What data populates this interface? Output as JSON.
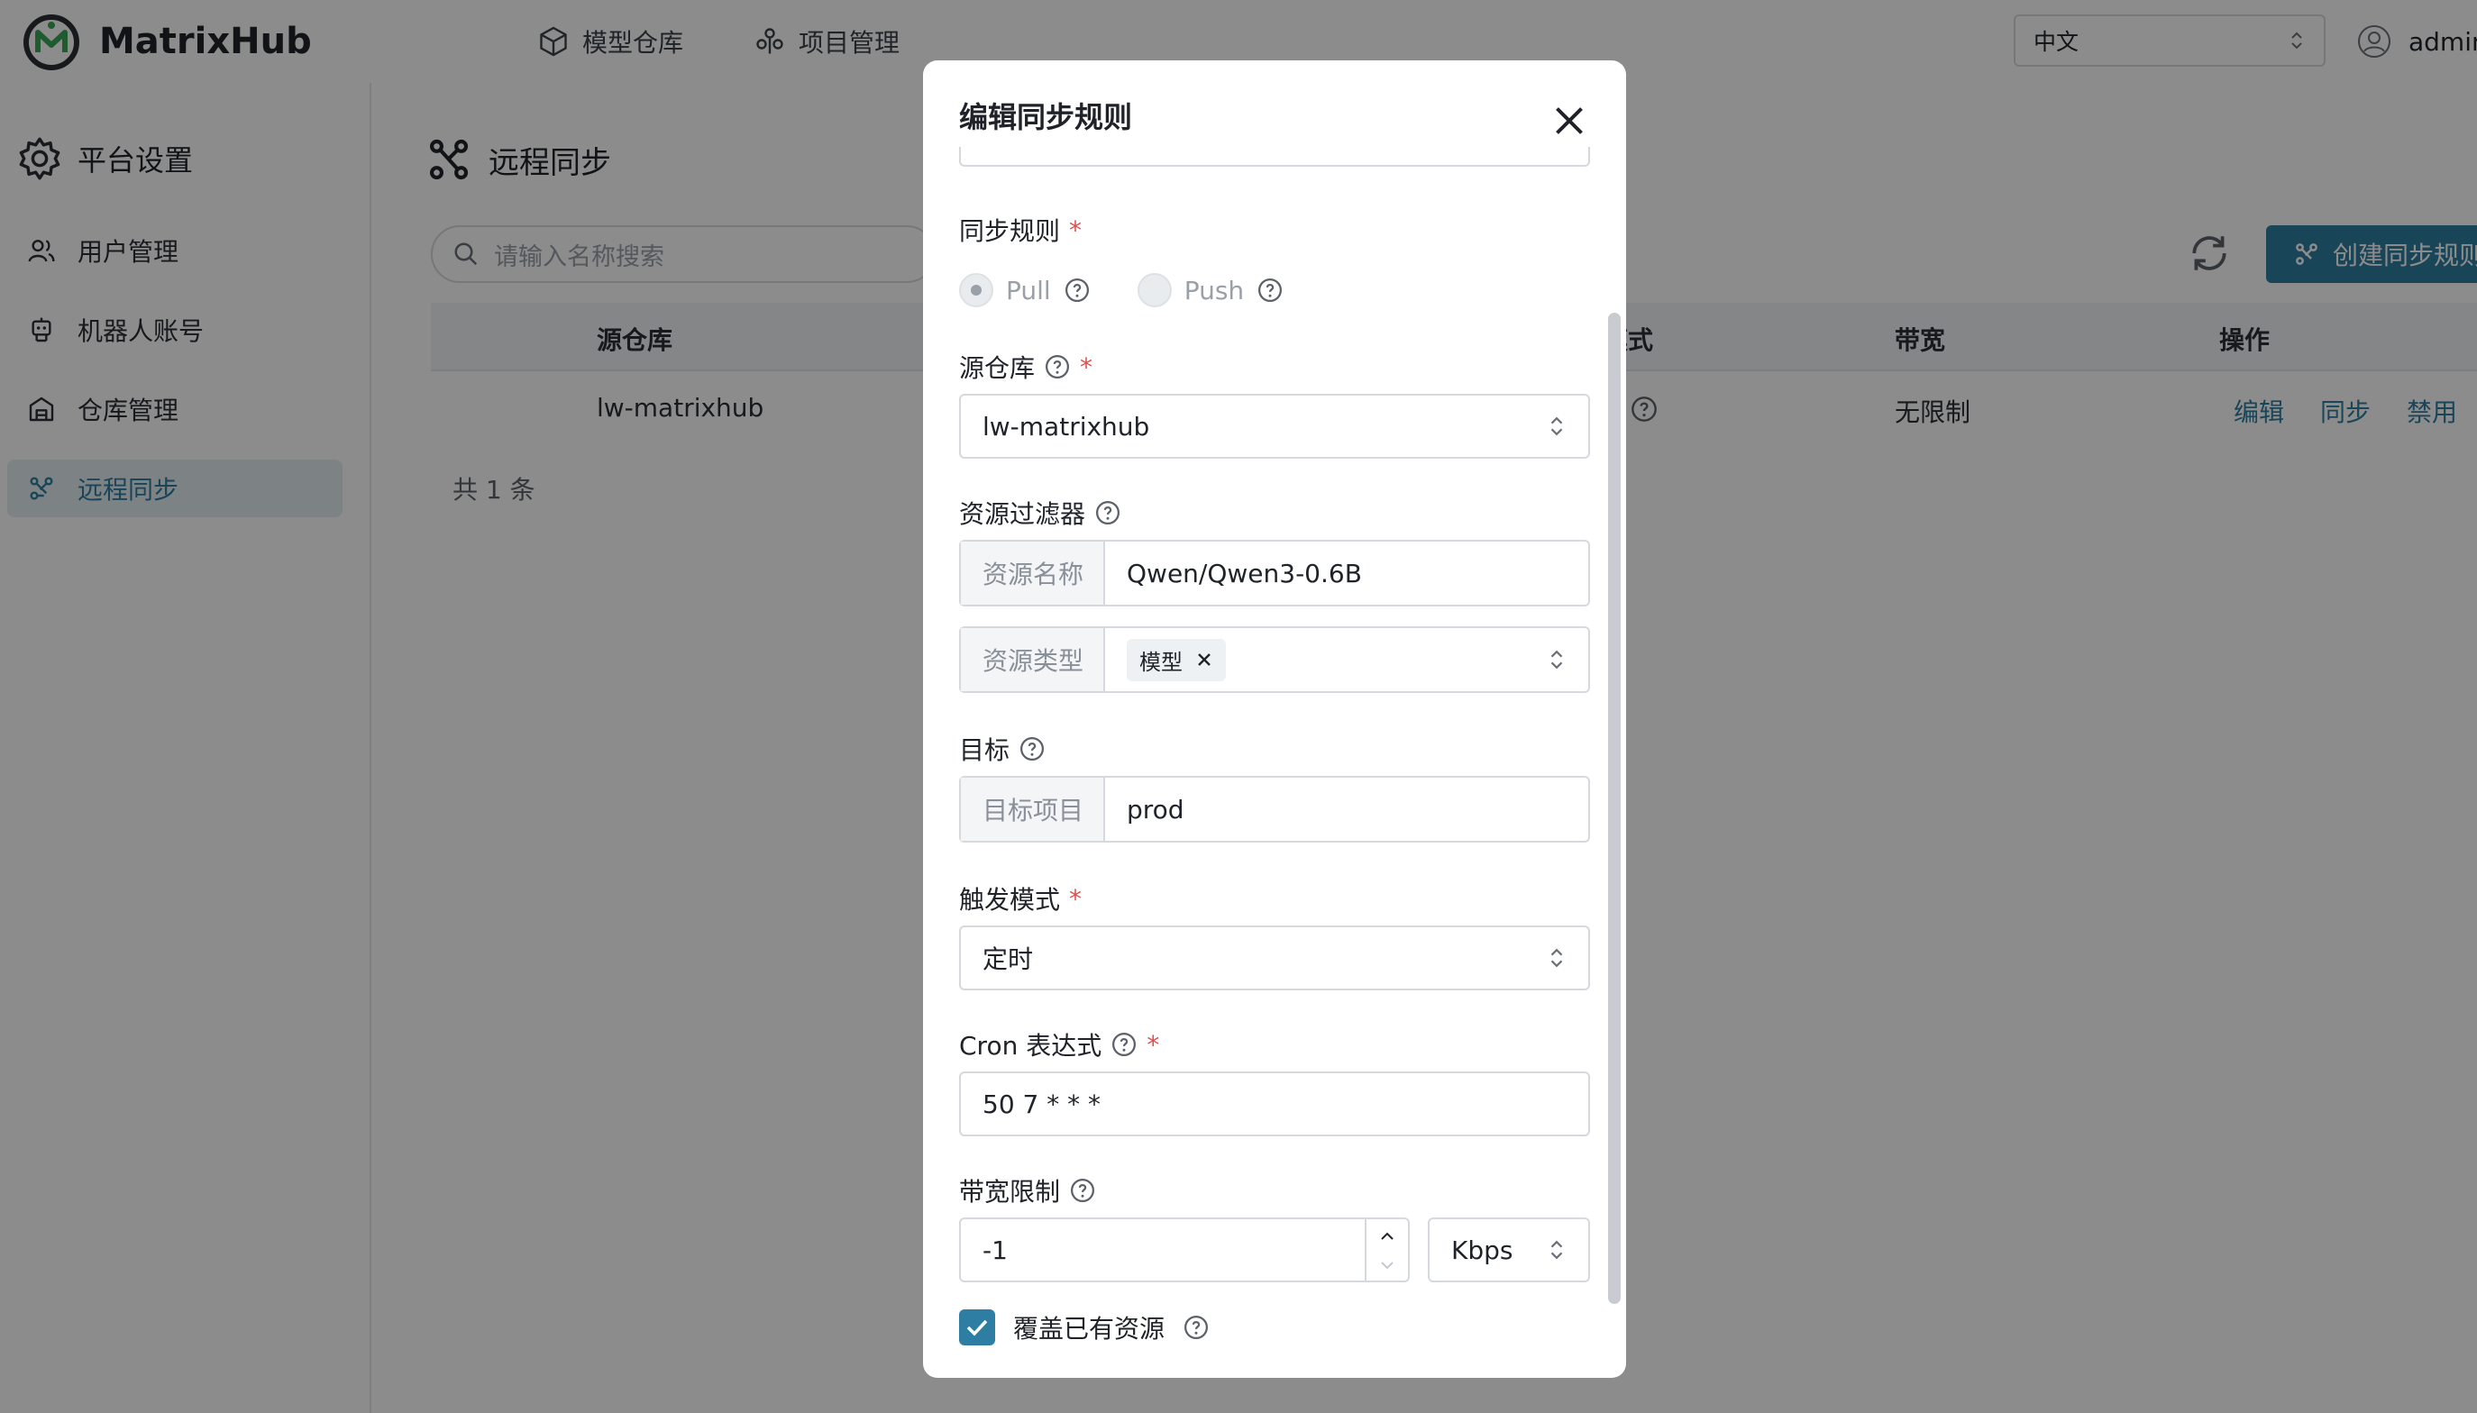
{
  "header": {
    "app_name": "MatrixHub",
    "nav": [
      {
        "label": "模型仓库",
        "icon": "cube-icon"
      },
      {
        "label": "项目管理",
        "icon": "project-icon"
      }
    ],
    "language": "中文",
    "user": "admin"
  },
  "sidebar": {
    "title": "平台设置",
    "items": [
      {
        "label": "用户管理",
        "icon": "users-icon"
      },
      {
        "label": "机器人账号",
        "icon": "robot-icon"
      },
      {
        "label": "仓库管理",
        "icon": "warehouse-icon"
      },
      {
        "label": "远程同步",
        "icon": "sync-icon",
        "active": true
      }
    ]
  },
  "main": {
    "title": "远程同步",
    "search_placeholder": "请输入名称搜索",
    "create_button": "创建同步规则",
    "columns": [
      "源仓库",
      "模式",
      "带宽",
      "操作"
    ],
    "rows": [
      {
        "source": "lw-matrixhub",
        "bandwidth": "无限制",
        "actions": [
          "编辑",
          "同步",
          "禁用"
        ]
      }
    ],
    "total": "共 1 条"
  },
  "modal": {
    "title": "编辑同步规则",
    "sync_rule": {
      "label": "同步规则",
      "options": [
        "Pull",
        "Push"
      ],
      "selected": "Pull"
    },
    "source_repo": {
      "label": "源仓库",
      "value": "lw-matrixhub"
    },
    "resource_filter": {
      "label": "资源过滤器",
      "name_addon": "资源名称",
      "name_value": "Qwen/Qwen3-0.6B",
      "type_addon": "资源类型",
      "type_tags": [
        "模型"
      ]
    },
    "target": {
      "label": "目标",
      "addon": "目标项目",
      "value": "prod"
    },
    "trigger_mode": {
      "label": "触发模式",
      "value": "定时"
    },
    "cron": {
      "label": "Cron 表达式",
      "value": "50 7 * * *"
    },
    "bandwidth": {
      "label": "带宽限制",
      "value": "-1",
      "unit": "Kbps"
    },
    "overwrite": {
      "label": "覆盖已有资源",
      "checked": true
    }
  }
}
